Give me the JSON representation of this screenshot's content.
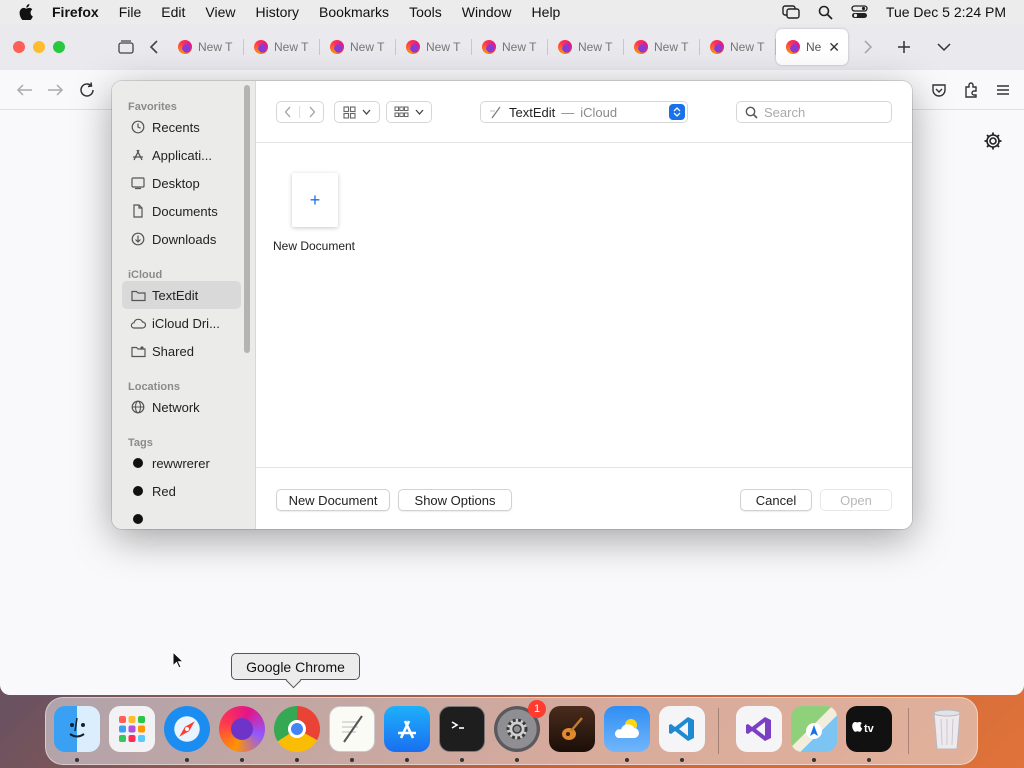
{
  "menubar": {
    "app_name": "Firefox",
    "items": [
      "File",
      "Edit",
      "View",
      "History",
      "Bookmarks",
      "Tools",
      "Window",
      "Help"
    ],
    "clock": "Tue Dec 5  2:24 PM"
  },
  "browser": {
    "tabs": [
      {
        "label": "New T"
      },
      {
        "label": "New T"
      },
      {
        "label": "New T"
      },
      {
        "label": "New T"
      },
      {
        "label": "New T"
      },
      {
        "label": "New T"
      },
      {
        "label": "New T"
      },
      {
        "label": "New T"
      }
    ],
    "active_tab": {
      "label": "Ne"
    }
  },
  "dialog": {
    "sidebar": {
      "favorites_label": "Favorites",
      "favorites": [
        {
          "label": "Recents",
          "icon": "clock-icon"
        },
        {
          "label": "Applicati...",
          "icon": "applications-icon"
        },
        {
          "label": "Desktop",
          "icon": "desktop-icon"
        },
        {
          "label": "Documents",
          "icon": "document-icon"
        },
        {
          "label": "Downloads",
          "icon": "download-icon"
        }
      ],
      "icloud_label": "iCloud",
      "icloud": [
        {
          "label": "TextEdit",
          "icon": "folder-icon",
          "selected": true
        },
        {
          "label": "iCloud Dri...",
          "icon": "cloud-icon"
        },
        {
          "label": "Shared",
          "icon": "shared-folder-icon"
        }
      ],
      "locations_label": "Locations",
      "locations": [
        {
          "label": "Network",
          "icon": "globe-icon"
        }
      ],
      "tags_label": "Tags",
      "tags": [
        {
          "label": "rewwrerer",
          "color": "#111111"
        },
        {
          "label": "Red",
          "color": "#111111"
        }
      ]
    },
    "location": {
      "folder": "TextEdit",
      "separator": "—",
      "service": "iCloud"
    },
    "search": {
      "placeholder": "Search"
    },
    "new_document_tile": {
      "symbol": "+",
      "label": "New Document"
    },
    "footer": {
      "new_document": "New Document",
      "show_options": "Show Options",
      "cancel": "Cancel",
      "open": "Open"
    }
  },
  "tooltip": {
    "text": "Google Chrome"
  },
  "dock": {
    "apps": [
      {
        "name": "finder-icon",
        "running": true
      },
      {
        "name": "launchpad-icon",
        "running": false
      },
      {
        "name": "safari-icon",
        "running": true
      },
      {
        "name": "firefox-icon",
        "running": true
      },
      {
        "name": "chrome-icon",
        "running": true
      },
      {
        "name": "textedit-icon",
        "running": true
      },
      {
        "name": "app-store-icon",
        "running": true
      },
      {
        "name": "terminal-icon",
        "running": true
      },
      {
        "name": "system-settings-icon",
        "running": true,
        "badge": "1"
      },
      {
        "name": "garageband-icon",
        "running": false
      },
      {
        "name": "weather-icon",
        "running": true
      },
      {
        "name": "vscode-icon",
        "running": true
      },
      {
        "name": "visual-studio-icon",
        "running": false
      },
      {
        "name": "maps-icon",
        "running": true
      },
      {
        "name": "apple-tv-icon",
        "running": true
      },
      {
        "name": "trash-icon",
        "running": false
      }
    ]
  },
  "colors": {
    "accent": "#1a72e8",
    "badge": "#ff3b30"
  }
}
